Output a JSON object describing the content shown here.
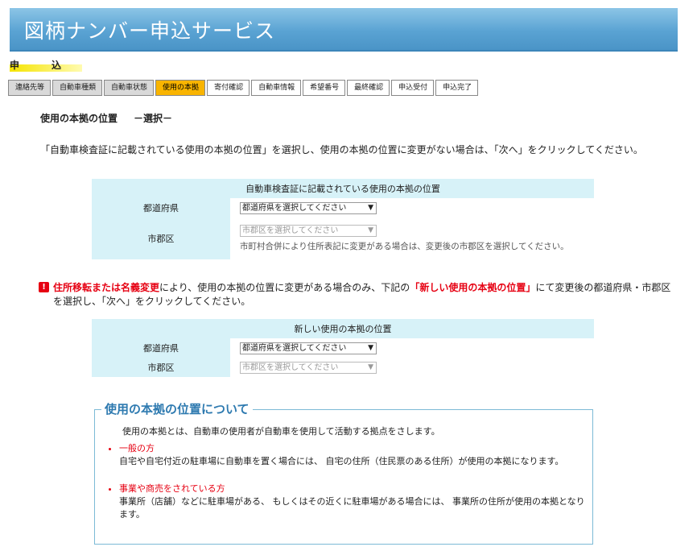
{
  "header": {
    "title": "図柄ナンバー申込サービス"
  },
  "section": {
    "char1": "申",
    "char2": "込"
  },
  "steps": [
    {
      "label": "連絡先等",
      "state": "done"
    },
    {
      "label": "自動車種類",
      "state": "done"
    },
    {
      "label": "自動車状態",
      "state": "done"
    },
    {
      "label": "使用の本拠",
      "state": "active"
    },
    {
      "label": "寄付確認",
      "state": "todo"
    },
    {
      "label": "自動車情報",
      "state": "todo"
    },
    {
      "label": "希望番号",
      "state": "todo"
    },
    {
      "label": "最終確認",
      "state": "todo"
    },
    {
      "label": "申込受付",
      "state": "todo"
    },
    {
      "label": "申込完了",
      "state": "todo"
    }
  ],
  "subtitle": {
    "main": "使用の本拠の位置",
    "sub": "－選択－"
  },
  "description": "「自動車検査証に記載されている使用の本拠の位置」を選択し、使用の本拠の位置に変更がない場合は、「次へ」をクリックしてください。",
  "registered": {
    "caption": "自動車検査証に記載されている使用の本拠の位置",
    "pref_label": "都道府県",
    "pref_value": "都道府県を選択してください",
    "city_label": "市郡区",
    "city_value": "市郡区を選択してください",
    "note": "市町村合併により住所表記に変更がある場合は、変更後の市郡区を選択してください。"
  },
  "warning": {
    "red1": "住所移転または名義変更",
    "text1": "により、使用の本拠の位置に変更がある場合のみ、下記の",
    "red2": "「新しい使用の本拠の位置」",
    "text2": "にて変更後の都道府県・市郡区を選択し、「次へ」をクリックしてください。"
  },
  "new_location": {
    "caption": "新しい使用の本拠の位置",
    "pref_label": "都道府県",
    "pref_value": "都道府県を選択してください",
    "city_label": "市郡区",
    "city_value": "市郡区を選択してください"
  },
  "about": {
    "title": "使用の本拠の位置について",
    "intro": "使用の本拠とは、自動車の使用者が自動車を使用して活動する拠点をさします。",
    "items": [
      {
        "head": "一般の方",
        "body": "自宅や自宅付近の駐車場に自動車を置く場合には、 自宅の住所（住民票のある住所）が使用の本拠になります。"
      },
      {
        "head": "事業や商売をされている方",
        "body": "事業所（店舗）などに駐車場がある、 もしくはその近くに駐車場がある場合には、 事業所の住所が使用の本拠となります。"
      }
    ]
  },
  "colors": {
    "accent": "#5aa3d3",
    "active_step": "#f9b400",
    "warning": "#e60012",
    "table_label_bg": "#d7f2f8"
  }
}
